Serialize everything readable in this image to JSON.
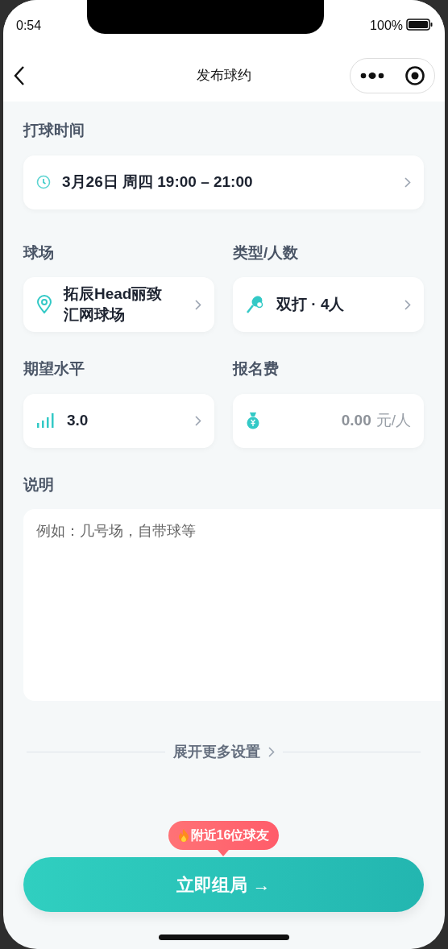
{
  "status_bar": {
    "time": "0:54",
    "battery": "100%"
  },
  "nav": {
    "title": "发布球约"
  },
  "time_field": {
    "label": "打球时间",
    "value": "3月26日 周四 19:00 – 21:00"
  },
  "court_field": {
    "label": "球场",
    "value": "拓辰Head丽致汇网球场"
  },
  "type_field": {
    "label": "类型/人数",
    "value": "双打 · 4人"
  },
  "level_field": {
    "label": "期望水平",
    "value": "3.0"
  },
  "fee_field": {
    "label": "报名费",
    "placeholder": "0.00",
    "unit": "元/人"
  },
  "note_field": {
    "label": "说明",
    "placeholder": "例如：几号场，自带球等"
  },
  "more_settings": {
    "label": "展开更多设置"
  },
  "tooltip": {
    "text": "附近16位球友"
  },
  "submit": {
    "label": "立即组局 →"
  }
}
